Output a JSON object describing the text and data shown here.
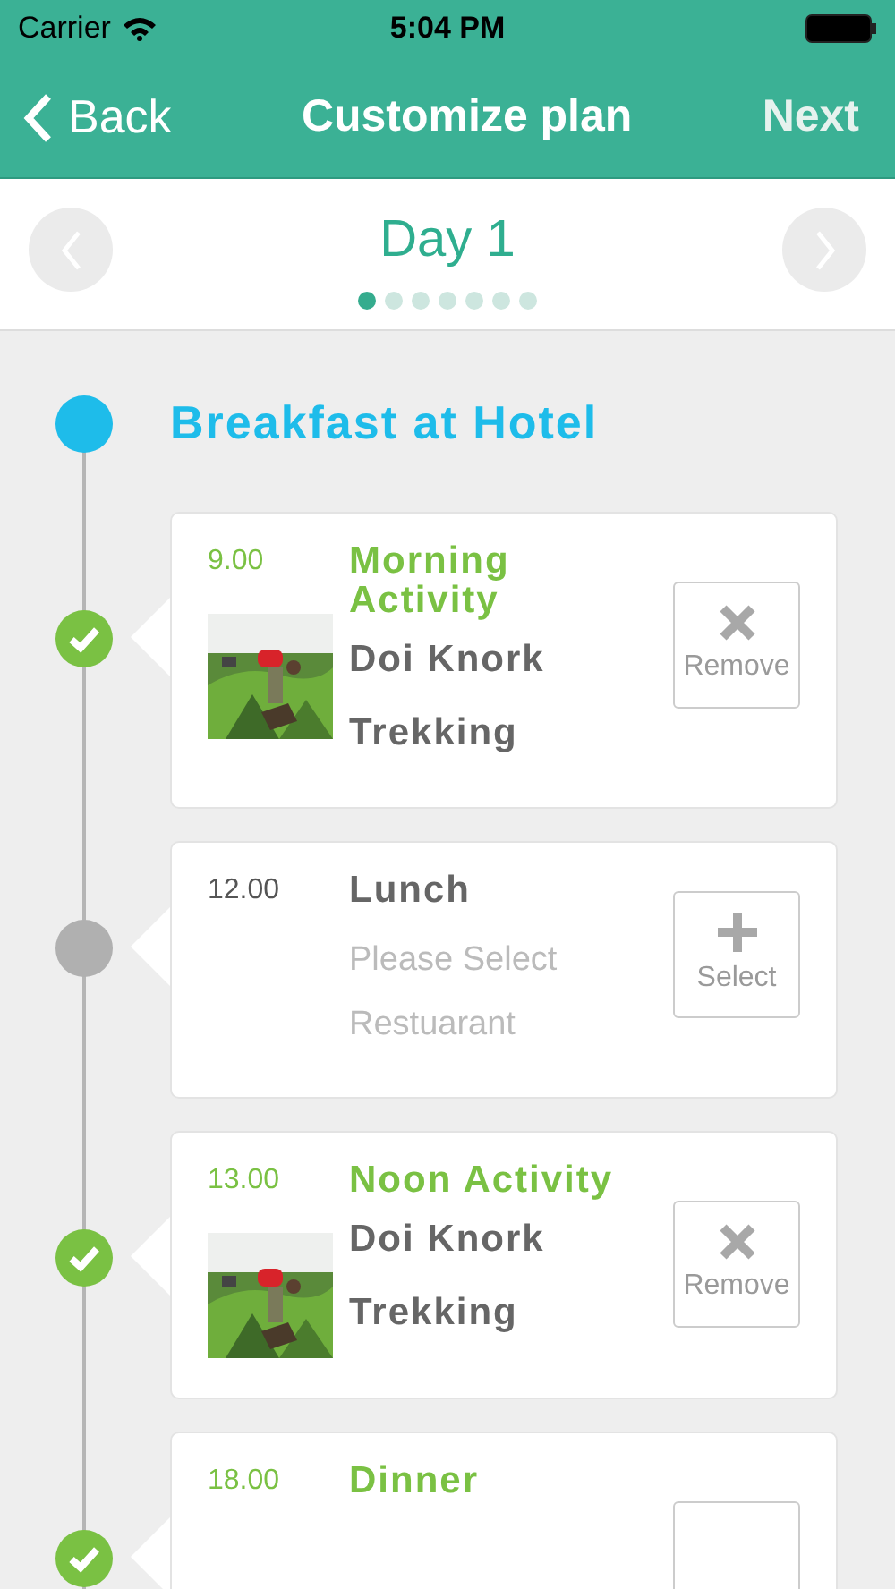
{
  "status_bar": {
    "carrier": "Carrier",
    "time": "5:04 PM"
  },
  "nav": {
    "back": "Back",
    "title": "Customize plan",
    "next": "Next"
  },
  "day": {
    "title": "Day 1",
    "pages": [
      {
        "selected": true
      },
      {
        "selected": false
      },
      {
        "selected": false
      },
      {
        "selected": false
      },
      {
        "selected": false
      },
      {
        "selected": false
      },
      {
        "selected": false
      }
    ]
  },
  "start": {
    "title": "Breakfast at Hotel"
  },
  "items": [
    {
      "time": "9.00",
      "title": "Morning Activity",
      "chosen": true,
      "details": [
        "Doi Knork",
        "Trekking"
      ],
      "action": "Remove"
    },
    {
      "time": "12.00",
      "title": "Lunch",
      "chosen": false,
      "placeholder": [
        "Please Select",
        "Restuarant"
      ],
      "action": "Select"
    },
    {
      "time": "13.00",
      "title": "Noon Activity",
      "chosen": true,
      "details": [
        "Doi Knork",
        "Trekking"
      ],
      "action": "Remove"
    },
    {
      "time": "18.00",
      "title": "Dinner",
      "chosen": true
    }
  ]
}
